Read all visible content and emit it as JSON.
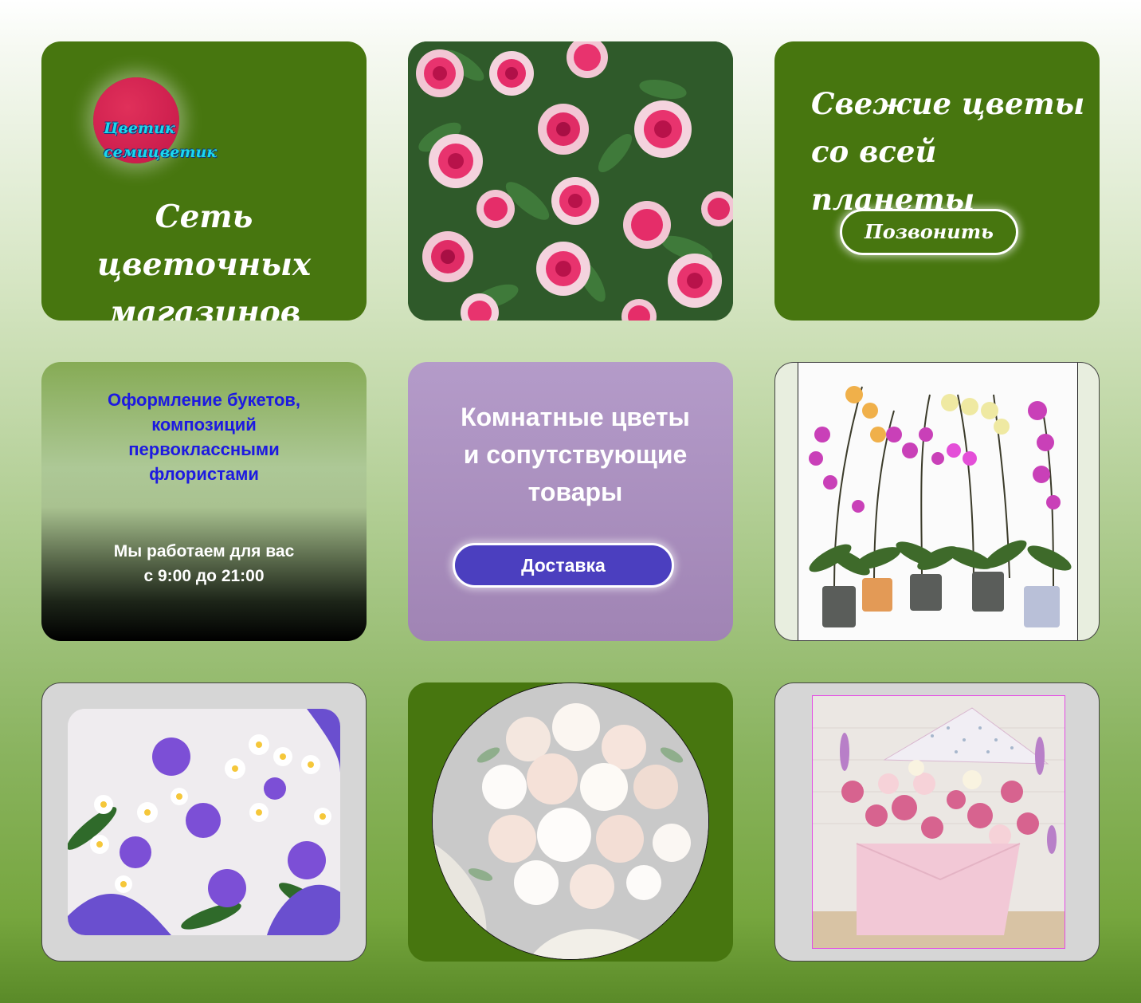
{
  "brand": {
    "logo_line1": "Цветик",
    "logo_line2": "семицветик"
  },
  "card1": {
    "title_line1": "Сеть цветочных",
    "title_line2": "магазинов"
  },
  "card3": {
    "title_line1": "Свежие цветы",
    "title_line2": "со всей планеты",
    "call_button": "Позвонить"
  },
  "card4": {
    "services_line1": "Оформление букетов,",
    "services_line2": "композиций",
    "services_line3": "первоклассными",
    "services_line4": "флористами",
    "hours_line1": "Мы работаем для вас",
    "hours_line2": "с 9:00 до 21:00"
  },
  "card5": {
    "title_line1": "Комнатные цветы",
    "title_line2": "и сопутствующие",
    "title_line3": "товары",
    "delivery_button": "Доставка"
  },
  "colors": {
    "card_green": "#47760f",
    "accent_blue": "#1d1ae0",
    "button_purple": "#4b3fbf",
    "logo_pink": "#d01d50",
    "logo_cyan": "#1ad8ee"
  }
}
